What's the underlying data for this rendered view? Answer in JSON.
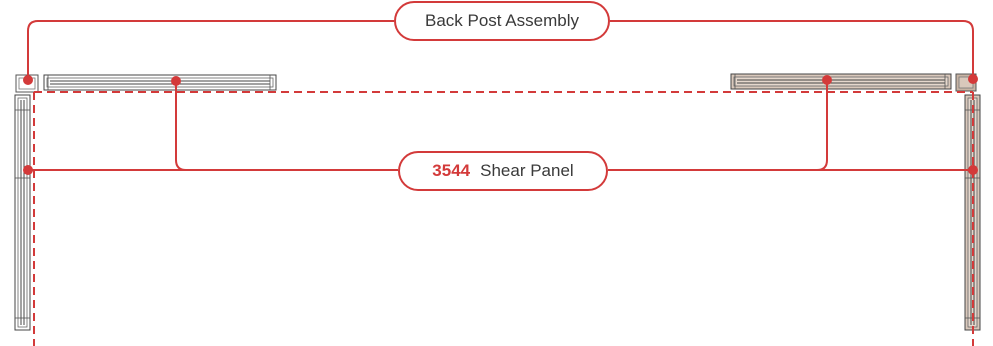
{
  "callouts": {
    "back_post": {
      "label": "Back Post Assembly"
    },
    "shear_panel": {
      "part_number": "3544",
      "label": "Shear Panel"
    }
  },
  "colors": {
    "callout_red": "#d33a3a",
    "drawing_gray": "#555555",
    "post_wood": "#c8b4a4",
    "text_dark": "#3a3a3a",
    "background": "#ffffff"
  }
}
